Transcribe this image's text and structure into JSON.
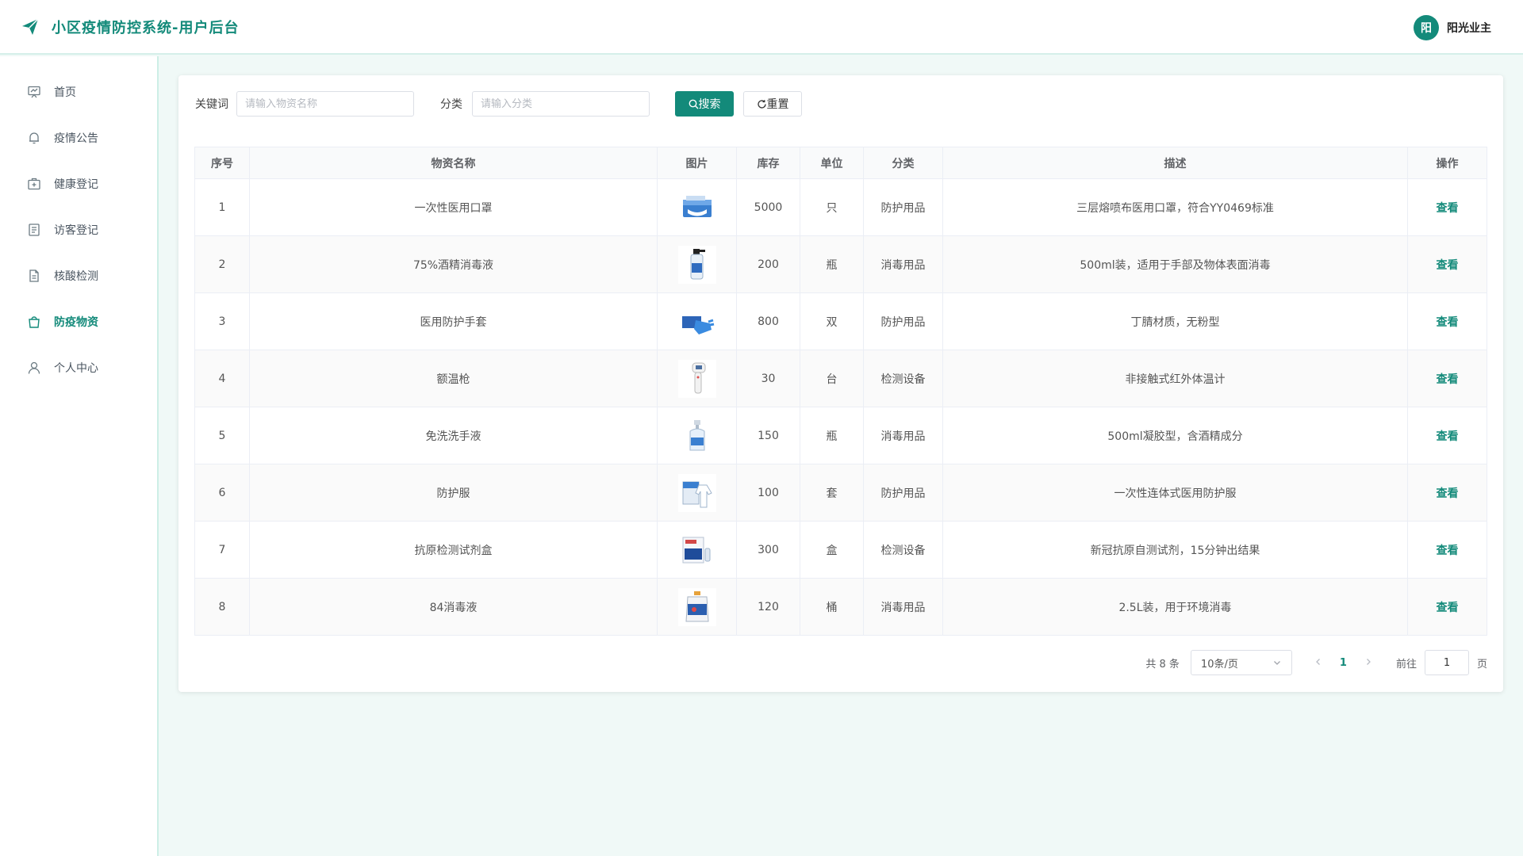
{
  "header": {
    "title": "小区疫情防控系统-用户后台",
    "user_avatar_text": "阳",
    "user_name": "阳光业主",
    "brand_icon": "paper-plane-icon"
  },
  "sidebar": {
    "active": "防疫物资",
    "items": [
      {
        "label": "首页",
        "icon": "monitor-icon"
      },
      {
        "label": "疫情公告",
        "icon": "bell-icon"
      },
      {
        "label": "健康登记",
        "icon": "medical-box-icon"
      },
      {
        "label": "访客登记",
        "icon": "notebook-icon"
      },
      {
        "label": "核酸检测",
        "icon": "document-icon"
      },
      {
        "label": "防疫物资",
        "icon": "bag-icon"
      },
      {
        "label": "个人中心",
        "icon": "user-icon"
      }
    ]
  },
  "filters": {
    "keyword_label": "关键词",
    "keyword_placeholder": "请输入物资名称",
    "keyword_value": "",
    "category_label": "分类",
    "category_placeholder": "请输入分类",
    "category_value": "",
    "search_label": "搜索",
    "reset_label": "重置"
  },
  "table": {
    "columns": [
      "序号",
      "物资名称",
      "图片",
      "库存",
      "单位",
      "分类",
      "描述",
      "操作"
    ],
    "action_label": "查看",
    "rows": [
      {
        "no": "1",
        "name": "一次性医用口罩",
        "stock": "5000",
        "unit": "只",
        "category": "防护用品",
        "desc": "三层熔喷布医用口罩，符合YY0469标准",
        "thumb": "mask-box"
      },
      {
        "no": "2",
        "name": "75%酒精消毒液",
        "stock": "200",
        "unit": "瓶",
        "category": "消毒用品",
        "desc": "500ml装，适用于手部及物体表面消毒",
        "thumb": "spray-bottle"
      },
      {
        "no": "3",
        "name": "医用防护手套",
        "stock": "800",
        "unit": "双",
        "category": "防护用品",
        "desc": "丁腈材质，无粉型",
        "thumb": "gloves"
      },
      {
        "no": "4",
        "name": "额温枪",
        "stock": "30",
        "unit": "台",
        "category": "检测设备",
        "desc": "非接触式红外体温计",
        "thumb": "thermometer"
      },
      {
        "no": "5",
        "name": "免洗洗手液",
        "stock": "150",
        "unit": "瓶",
        "category": "消毒用品",
        "desc": "500ml凝胶型，含酒精成分",
        "thumb": "pump-bottle"
      },
      {
        "no": "6",
        "name": "防护服",
        "stock": "100",
        "unit": "套",
        "category": "防护用品",
        "desc": "一次性连体式医用防护服",
        "thumb": "protective-suit"
      },
      {
        "no": "7",
        "name": "抗原检测试剂盒",
        "stock": "300",
        "unit": "盒",
        "category": "检测设备",
        "desc": "新冠抗原自测试剂，15分钟出结果",
        "thumb": "test-kit"
      },
      {
        "no": "8",
        "name": "84消毒液",
        "stock": "120",
        "unit": "桶",
        "category": "消毒用品",
        "desc": "2.5L装，用于环境消毒",
        "thumb": "disinfectant-jug"
      }
    ]
  },
  "pagination": {
    "total_text": "共 8 条",
    "page_size": "10条/页",
    "current_page": "1",
    "goto_label": "前往",
    "goto_value": "1",
    "page_suffix": "页"
  },
  "colors": {
    "accent": "#138a7a",
    "background": "#f0f9f7"
  }
}
